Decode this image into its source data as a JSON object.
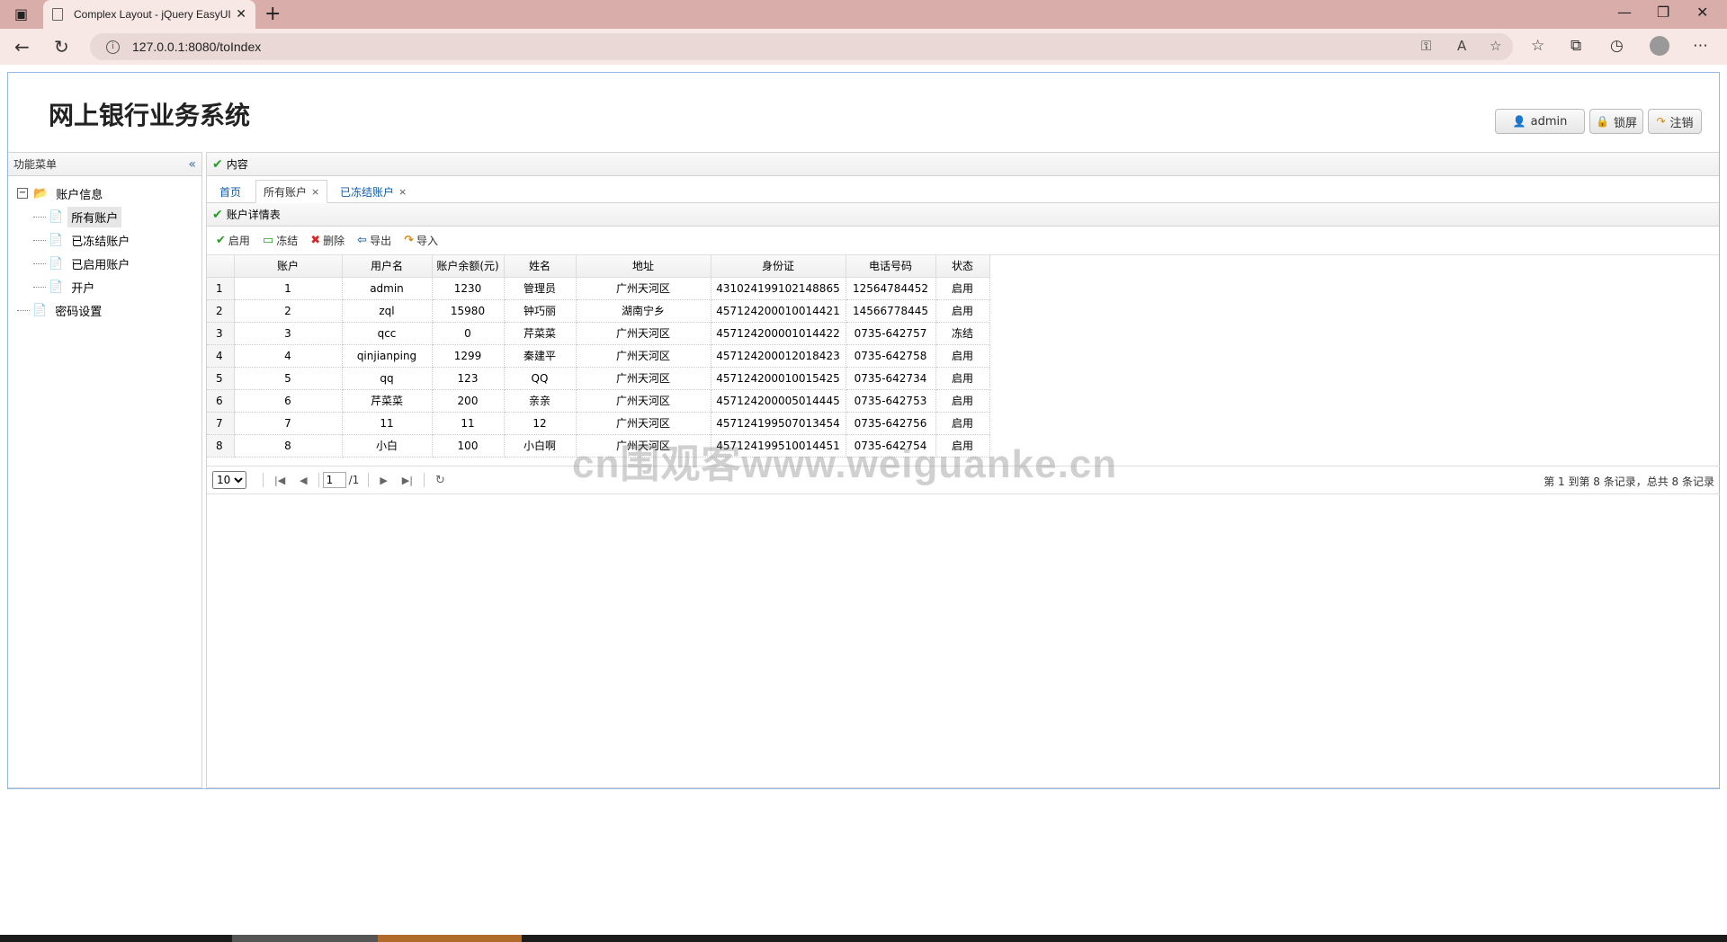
{
  "browser": {
    "tab_title": "Complex Layout - jQuery EasyUI",
    "url": "127.0.0.1:8080/toIndex"
  },
  "header": {
    "title": "网上银行业务系统",
    "user_label": "admin",
    "lock_label": "锁屏",
    "logout_label": "注销"
  },
  "menu": {
    "title": "功能菜单",
    "root": "账户信息",
    "items": [
      "所有账户",
      "已冻结账户",
      "已启用账户",
      "开户"
    ],
    "password": "密码设置"
  },
  "content": {
    "title": "内容",
    "tabs": [
      "首页",
      "所有账户",
      "已冻结账户"
    ],
    "panel_title": "账户详情表",
    "toolbar": [
      "启用",
      "冻结",
      "删除",
      "导出",
      "导入"
    ]
  },
  "grid": {
    "columns": [
      "账户",
      "用户名",
      "账户余额(元)",
      "姓名",
      "地址",
      "身份证",
      "电话号码",
      "状态"
    ],
    "rows": [
      [
        "1",
        "1",
        "admin",
        "1230",
        "管理员",
        "广州天河区",
        "431024199102148865",
        "12564784452",
        "启用"
      ],
      [
        "2",
        "2",
        "zql",
        "15980",
        "钟巧丽",
        "湖南宁乡",
        "457124200010014421",
        "14566778445",
        "启用"
      ],
      [
        "3",
        "3",
        "qcc",
        "0",
        "芹菜菜",
        "广州天河区",
        "457124200001014422",
        "0735-642757",
        "冻结"
      ],
      [
        "4",
        "4",
        "qinjianping",
        "1299",
        "秦建平",
        "广州天河区",
        "457124200012018423",
        "0735-642758",
        "启用"
      ],
      [
        "5",
        "5",
        "qq",
        "123",
        "QQ",
        "广州天河区",
        "457124200010015425",
        "0735-642734",
        "启用"
      ],
      [
        "6",
        "6",
        "芹菜菜",
        "200",
        "亲亲",
        "广州天河区",
        "457124200005014445",
        "0735-642753",
        "启用"
      ],
      [
        "7",
        "7",
        "11",
        "11",
        "12",
        "广州天河区",
        "457124199507013454",
        "0735-642756",
        "启用"
      ],
      [
        "8",
        "8",
        "小白",
        "100",
        "小白啊",
        "广州天河区",
        "457124199510014451",
        "0735-642754",
        "启用"
      ]
    ]
  },
  "pager": {
    "page_size": "10",
    "page": "1",
    "total_pages": "/1",
    "info": "第 1 到第 8 条记录，总共 8 条记录"
  },
  "watermark": "cn围观客www.weiguanke.cn"
}
